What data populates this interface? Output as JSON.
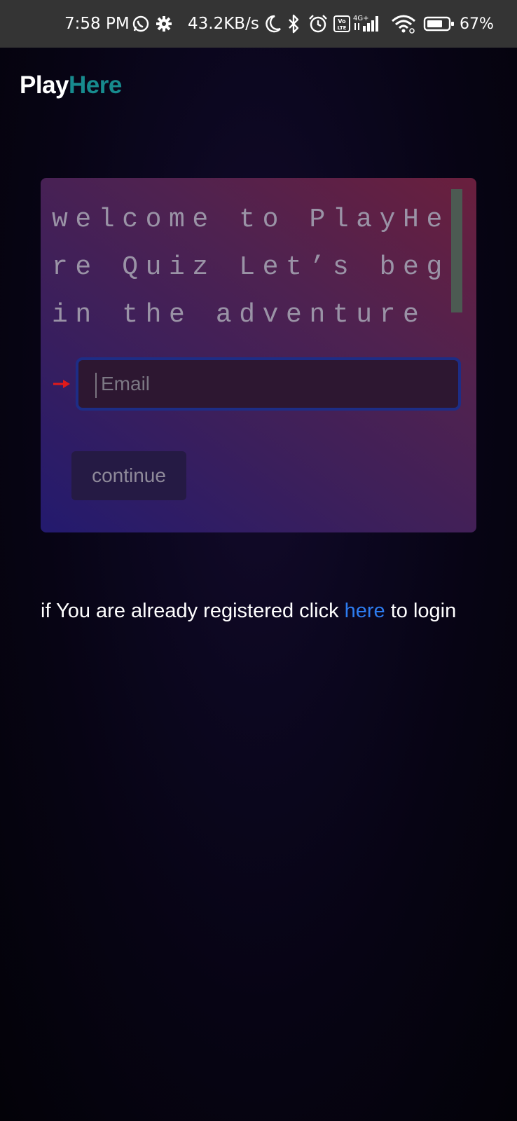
{
  "status_bar": {
    "time": "7:58 PM",
    "net_speed": "43.2KB/s",
    "network_type": "4G+",
    "volte_label": "Vo LTE",
    "battery_pct": "67%",
    "icons": [
      "whatsapp-icon",
      "gear-icon",
      "moon-icon",
      "bluetooth-icon",
      "alarm-icon",
      "volte-icon",
      "signal-icon",
      "wifi-icon",
      "battery-icon"
    ]
  },
  "header": {
    "logo_part1": "Play",
    "logo_part2": "Here",
    "logo_accent_color": "#178b8e"
  },
  "card": {
    "welcome_text": "welcome to PlayHere Quiz Let’s begin the adventure",
    "email": {
      "value": "",
      "placeholder": "Email"
    },
    "continue_label": "continue"
  },
  "login_prompt": {
    "prefix": "if You are already registered click ",
    "link_label": "here",
    "suffix": " to login",
    "link_color": "#2d7cf0"
  }
}
